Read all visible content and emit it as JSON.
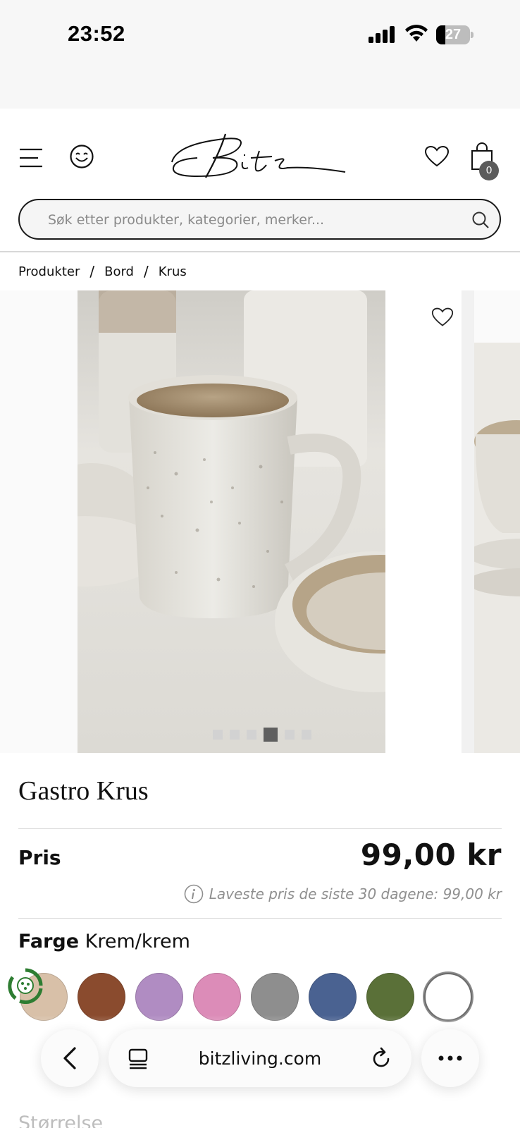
{
  "status_bar": {
    "time": "23:52",
    "battery": "27",
    "battery_level": 0.27
  },
  "header": {
    "logo_text": "Bitz",
    "cart_count": "0",
    "search_placeholder": "Søk etter produkter, kategorier, merker..."
  },
  "breadcrumb": [
    {
      "label": "Produkter"
    },
    {
      "label": "Bord"
    },
    {
      "label": "Krus"
    }
  ],
  "breadcrumb_separator": "/",
  "gallery": {
    "total_images": 6,
    "active_index": 3
  },
  "product": {
    "title": "Gastro Krus",
    "price_label": "Pris",
    "price": "99,00 kr",
    "lowest_price_note": "Laveste pris de siste 30 dagene: 99,00 kr",
    "color_label": "Farge",
    "color_value": "Krem/krem",
    "size_label": "Størrelse",
    "swatches": [
      {
        "name": "beige",
        "color": "#d8c0a8"
      },
      {
        "name": "brown",
        "color": "#8a4b2e"
      },
      {
        "name": "lilac",
        "color": "#b08cc2"
      },
      {
        "name": "pink",
        "color": "#dc8cb8"
      },
      {
        "name": "grey",
        "color": "#8e8e8e"
      },
      {
        "name": "blue",
        "color": "#4a6291"
      },
      {
        "name": "green",
        "color": "#5a7038"
      },
      {
        "name": "white",
        "color": "#ffffff"
      }
    ]
  },
  "browser": {
    "url": "bitzliving.com"
  }
}
